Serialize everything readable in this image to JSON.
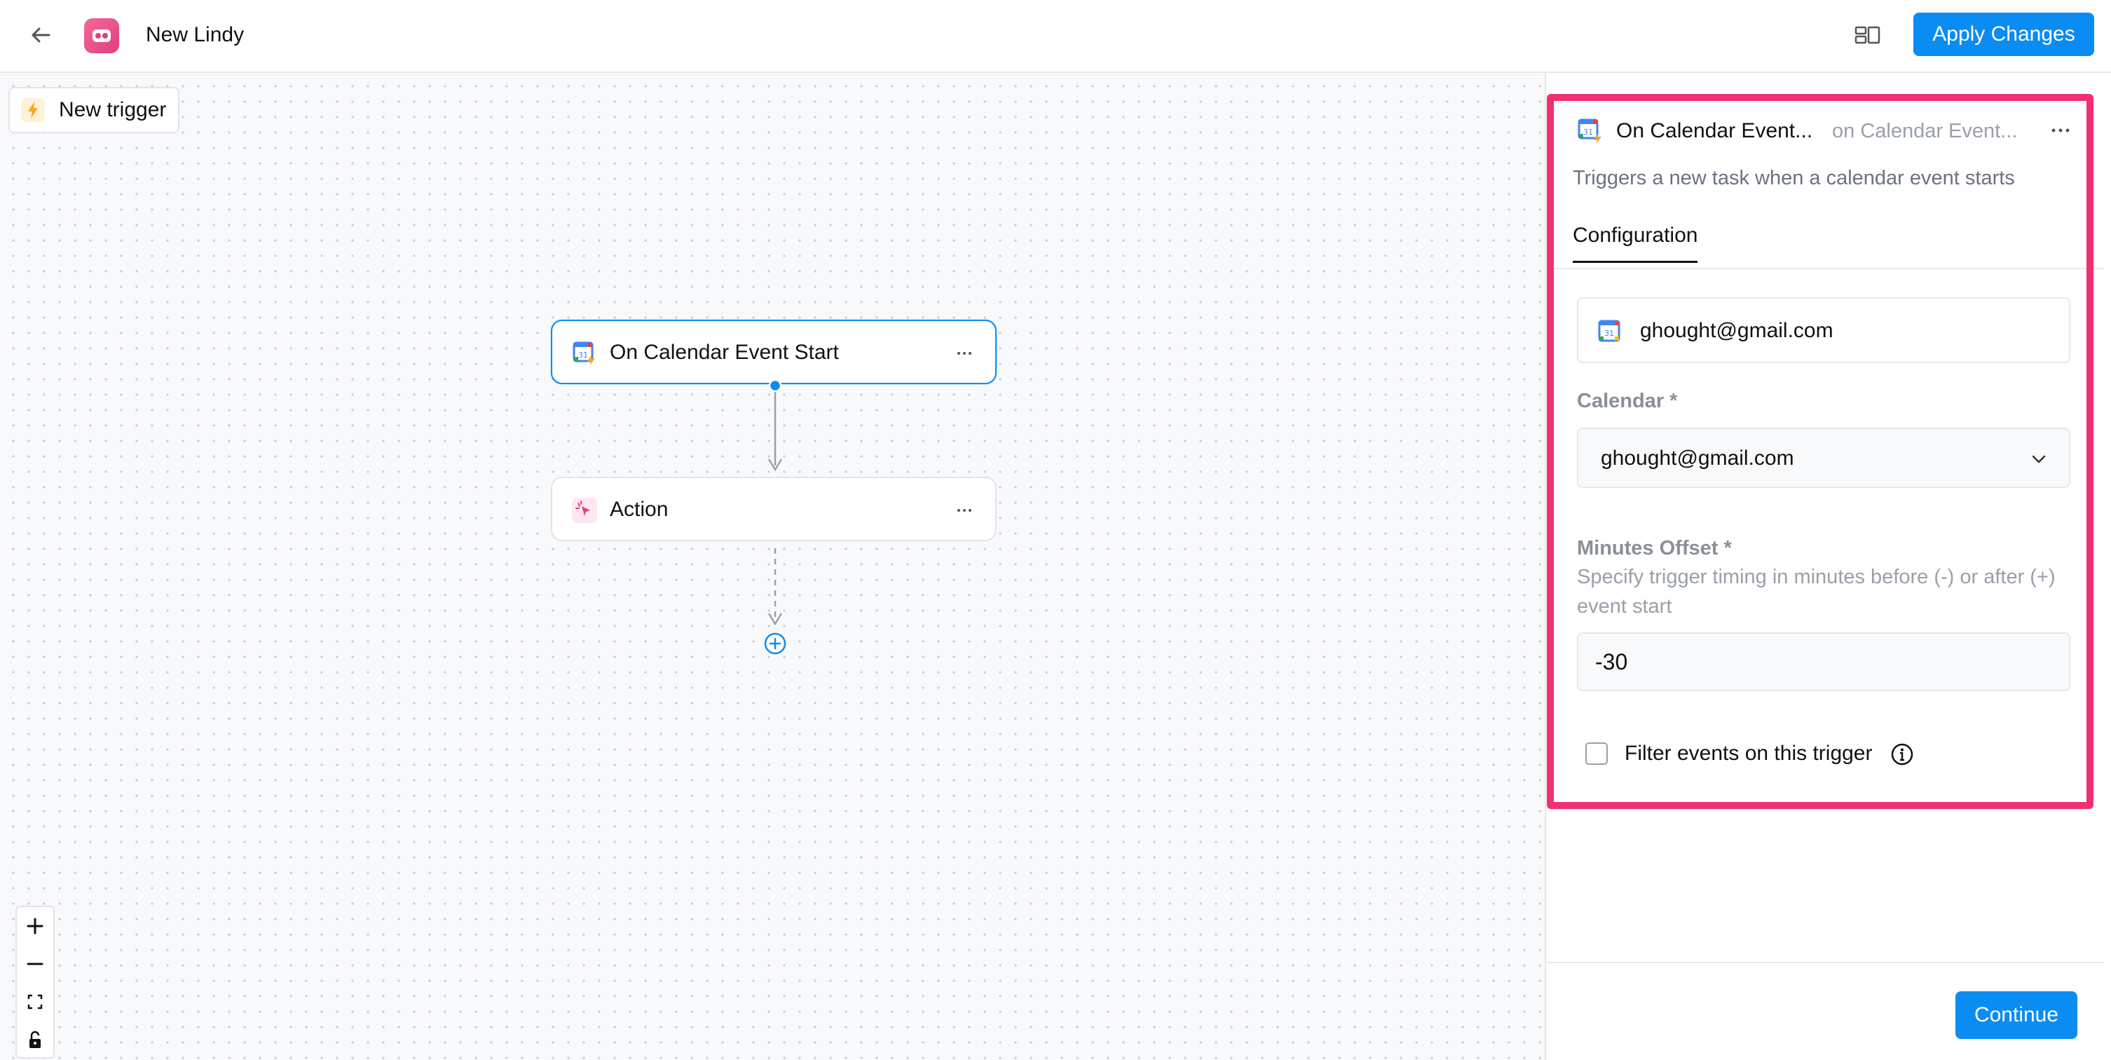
{
  "header": {
    "title": "New Lindy",
    "apply_label": "Apply Changes",
    "back_icon": "arrow-left-icon",
    "layout_icon": "layout-icon"
  },
  "canvas": {
    "new_trigger_label": "New trigger",
    "nodes": [
      {
        "label": "On Calendar Event Start",
        "icon": "google-calendar-icon",
        "selected": true
      },
      {
        "label": "Action",
        "icon": "sparkle-cursor-icon",
        "selected": false
      }
    ],
    "zoom_controls": [
      "zoom-in-icon",
      "zoom-out-icon",
      "fit-view-icon",
      "lock-icon"
    ]
  },
  "panel": {
    "title": "On Calendar Event...",
    "subtitle": "on Calendar Event...",
    "description": "Triggers a new task when a calendar event starts",
    "tabs": [
      "Configuration"
    ],
    "account": "ghought@gmail.com",
    "calendar_label": "Calendar *",
    "calendar_value": "ghought@gmail.com",
    "minutes_label": "Minutes Offset *",
    "minutes_help": "Specify trigger timing in minutes before (-) or after (+) event start",
    "minutes_value": "-30",
    "filter_label": "Filter events on this trigger",
    "filter_checked": false,
    "continue_label": "Continue"
  },
  "colors": {
    "accent": "#0b8cf2",
    "highlight": "#f0306f",
    "brand": "#e0407e"
  }
}
